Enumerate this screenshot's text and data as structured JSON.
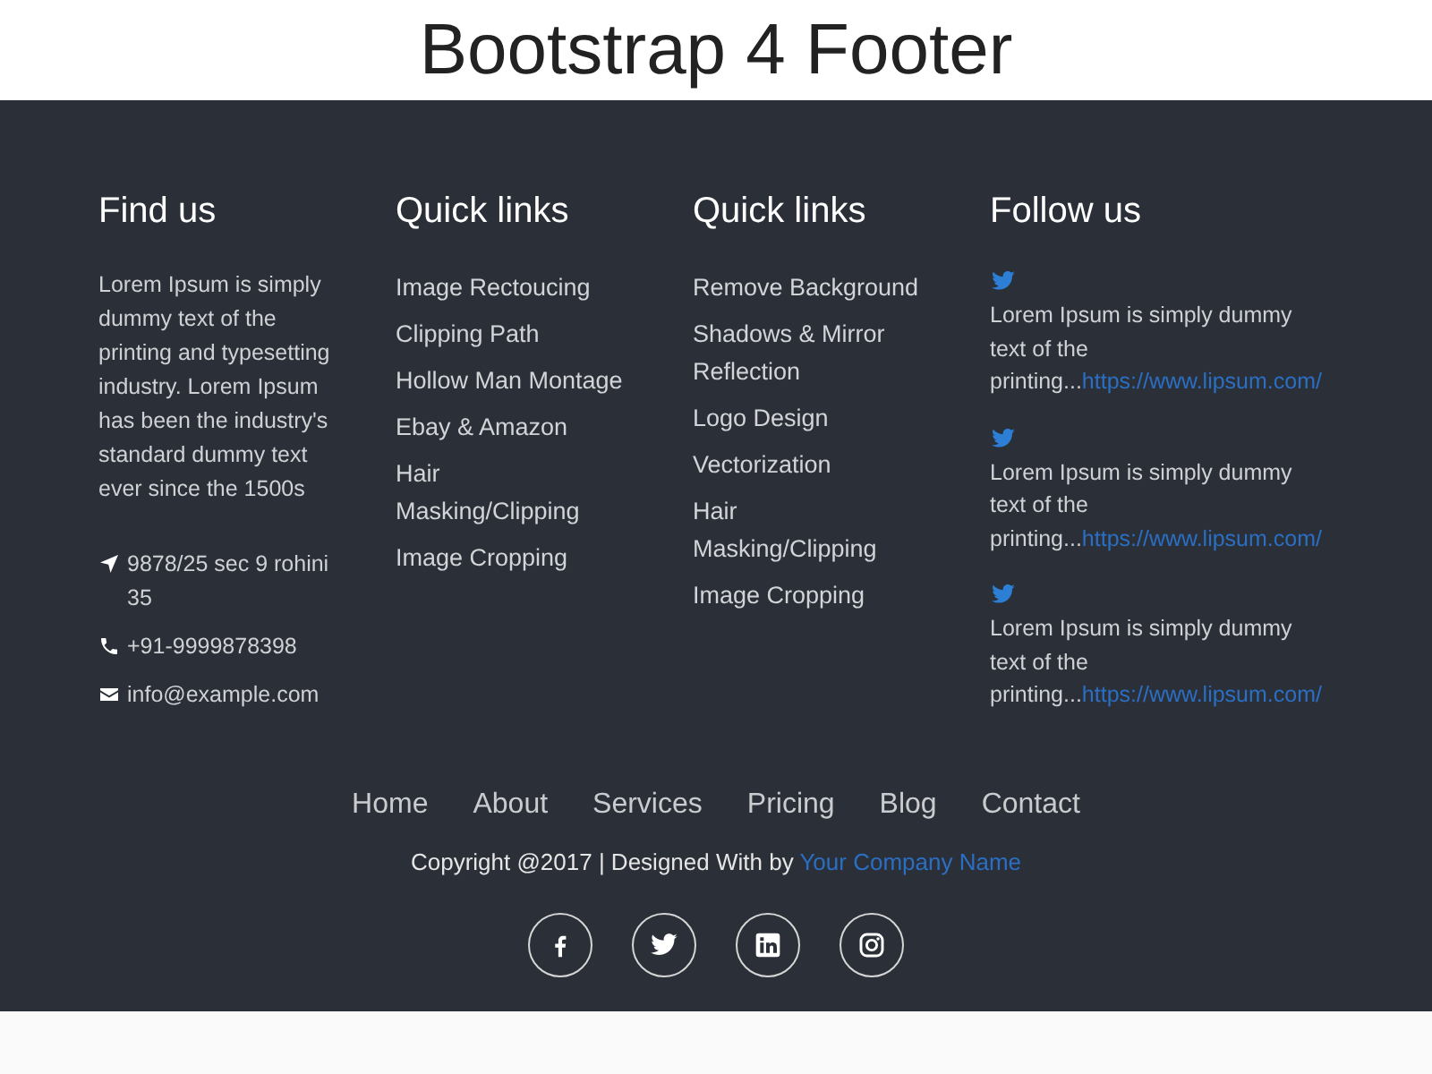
{
  "page_title": "Bootstrap 4 Footer",
  "columns": [
    {
      "kind": "about",
      "heading": "Find us",
      "text": "Lorem Ipsum is simply dummy text of the printing and typesetting industry. Lorem Ipsum has been the industry's standard dummy text ever since the 1500s",
      "contacts": [
        {
          "kind": "location",
          "text": "9878/25 sec 9 rohini 35"
        },
        {
          "kind": "phone",
          "text": "+91-9999878398"
        },
        {
          "kind": "email",
          "text": "info@example.com"
        }
      ]
    },
    {
      "kind": "links",
      "heading": "Quick links",
      "links": [
        "Image Rectoucing",
        "Clipping Path",
        "Hollow Man Montage",
        "Ebay & Amazon",
        "Hair Masking/Clipping",
        "Image Cropping"
      ]
    },
    {
      "kind": "links",
      "heading": "Quick links",
      "links": [
        "Remove Background",
        "Shadows & Mirror Reflection",
        "Logo Design",
        "Vectorization",
        "Hair Masking/Clipping",
        "Image Cropping"
      ]
    },
    {
      "kind": "tweets",
      "heading": "Follow us",
      "tweets": [
        {
          "text": "Lorem Ipsum is simply dummy text of the printing...",
          "link": "https://www.lipsum.com/"
        },
        {
          "text": "Lorem Ipsum is simply dummy text of the printing...",
          "link": "https://www.lipsum.com/"
        },
        {
          "text": "Lorem Ipsum is simply dummy text of the printing...",
          "link": "https://www.lipsum.com/"
        }
      ]
    }
  ],
  "nav": [
    "Home",
    "About",
    "Services",
    "Pricing",
    "Blog",
    "Contact"
  ],
  "copyright": {
    "text": "Copyright @2017 | Designed With by ",
    "link": "Your Company Name"
  },
  "social": [
    {
      "kind": "facebook"
    },
    {
      "kind": "twitter"
    },
    {
      "kind": "linkedin"
    },
    {
      "kind": "instagram"
    }
  ]
}
